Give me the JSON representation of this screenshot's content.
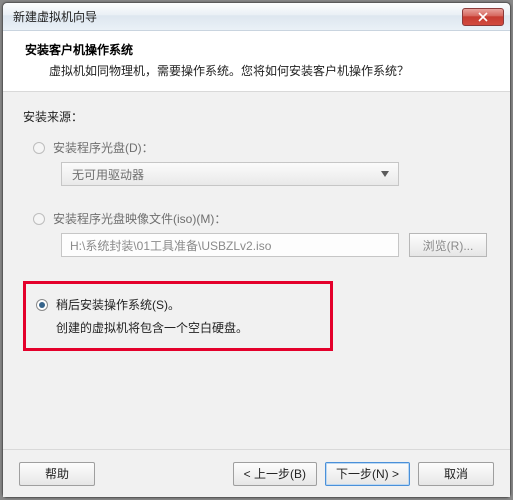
{
  "window": {
    "title": "新建虚拟机向导"
  },
  "header": {
    "title": "安装客户机操作系统",
    "subtitle": "虚拟机如同物理机，需要操作系统。您将如何安装客户机操作系统？"
  },
  "source": {
    "label": "安装来源：",
    "opt_disc": "安装程序光盘(D)：",
    "disc_value": "无可用驱动器",
    "opt_iso": "安装程序光盘映像文件(iso)(M)：",
    "iso_value": "H:\\系统封装\\01工具准备\\USBZLv2.iso",
    "browse": "浏览(R)...",
    "opt_later": "稍后安装操作系统(S)。",
    "later_note": "创建的虚拟机将包含一个空白硬盘。"
  },
  "footer": {
    "help": "帮助",
    "back": "< 上一步(B)",
    "next": "下一步(N) >",
    "cancel": "取消"
  }
}
